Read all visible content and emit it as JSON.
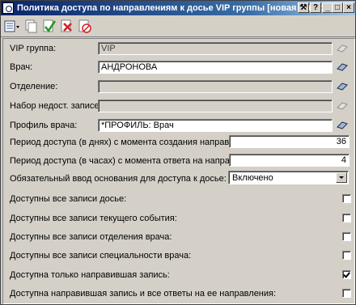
{
  "window": {
    "title": "Политика доступа по направлениям к досье VIP группы [новая запись]"
  },
  "titlebar_buttons": [
    {
      "name": "tools-icon",
      "glyph": "⚒"
    },
    {
      "name": "help-icon",
      "glyph": "?"
    },
    {
      "name": "minimize-icon",
      "glyph": "_"
    },
    {
      "name": "maximize-icon",
      "glyph": "□"
    },
    {
      "name": "close-icon",
      "glyph": "×"
    }
  ],
  "toolbar": {
    "tools": [
      "menu-icon",
      "copy-icon",
      "confirm-icon",
      "delete-icon",
      "cancel-icon"
    ]
  },
  "form": {
    "vip_group": {
      "label": "VIP группа:",
      "value": "VIP"
    },
    "doctor": {
      "label": "Врач:",
      "value": "АНДРОНОВА"
    },
    "department": {
      "label": "Отделение:",
      "value": ""
    },
    "record_set": {
      "label": "Набор недост. записей:",
      "value": ""
    },
    "doctor_profile": {
      "label": "Профиль врача:",
      "value": "*ПРОФИЛЬ: Врач"
    },
    "period_days": {
      "label": "Период доступа (в днях) с момента создания направления:",
      "value": "36"
    },
    "period_hours": {
      "label": "Период доступа (в часах) с момента ответа на направление:",
      "value": "4"
    },
    "required_reason": {
      "label": "Обязательный ввод основания для доступа к досье:",
      "value": "Включено"
    }
  },
  "checks": [
    {
      "label": "Доступны все записи досье:",
      "checked": false
    },
    {
      "label": "Доступны все записи текущего события:",
      "checked": false
    },
    {
      "label": "Доступны все записи отделения врача:",
      "checked": false
    },
    {
      "label": "Доступны все записи специальности врача:",
      "checked": false
    },
    {
      "label": "Доступна только направившая запись:",
      "checked": true
    },
    {
      "label": "Доступна направившая запись и все ответы на ее направления:",
      "checked": false
    }
  ],
  "colors": {
    "titlebar_start": "#0a246a",
    "titlebar_end": "#a6caf0",
    "face": "#d4d0c8",
    "confirm_green": "#1e9a1e",
    "delete_red": "#d02020"
  }
}
